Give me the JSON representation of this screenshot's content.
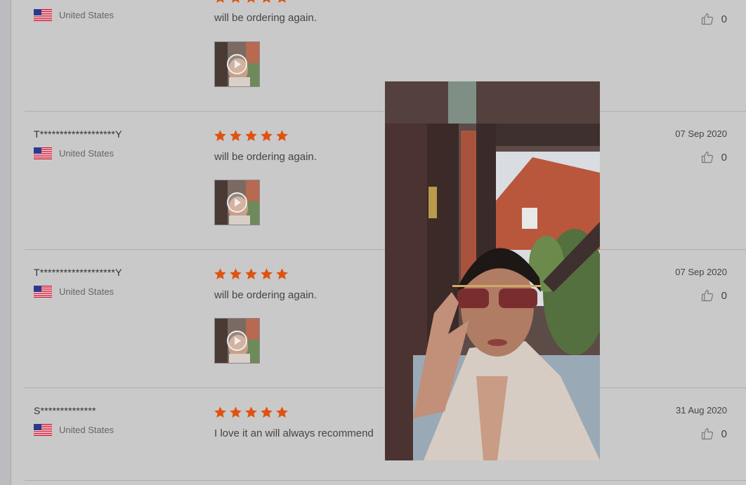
{
  "reviews": [
    {
      "reviewer": "",
      "country": "United States",
      "text": "will be ordering again.",
      "date": "",
      "likes": "0",
      "rating": 5
    },
    {
      "reviewer": "T*******************Y",
      "country": "United States",
      "text": "will be ordering again.",
      "date": "07 Sep 2020",
      "likes": "0",
      "rating": 5
    },
    {
      "reviewer": "T*******************Y",
      "country": "United States",
      "text": "will be ordering again.",
      "date": "07 Sep 2020",
      "likes": "0",
      "rating": 5
    },
    {
      "reviewer": "S**************",
      "country": "United States",
      "text": "I love it  an will always recommend",
      "date": "31 Aug 2020",
      "likes": "0",
      "rating": 5
    }
  ],
  "colors": {
    "star": "#e0520f",
    "background": "#c9c9c9"
  },
  "icons": {
    "like": "thumbs-up-icon",
    "play": "play-icon",
    "flag": "us-flag-icon"
  }
}
